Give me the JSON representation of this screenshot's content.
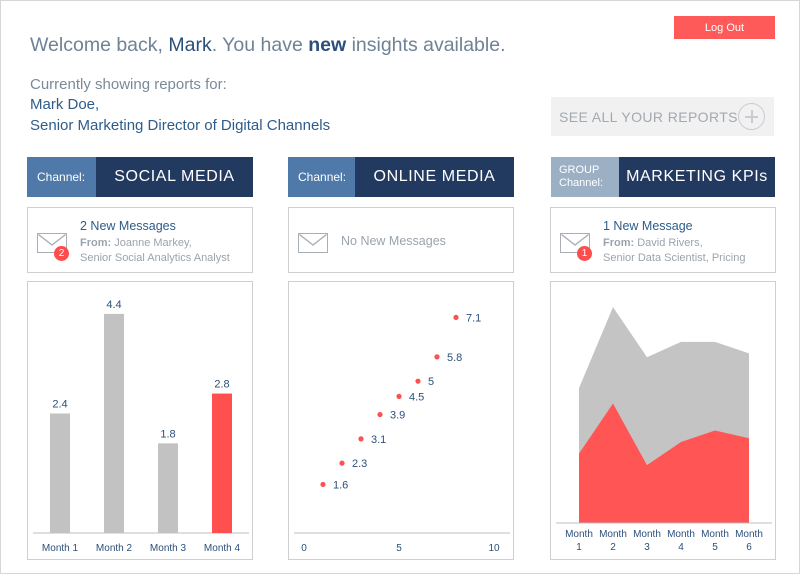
{
  "header": {
    "logout_label": "Log Out",
    "welcome_prefix": "Welcome back, ",
    "welcome_name": "Mark",
    "welcome_mid": ". You have ",
    "welcome_new": "new",
    "welcome_suffix": " insights available.",
    "currently_label": "Currently showing reports for:",
    "user_name": "Mark Doe,",
    "user_title": "Senior Marketing Director of Digital Channels",
    "see_all_label": "SEE ALL YOUR REPORTS"
  },
  "panels": [
    {
      "channel_label": "Channel:",
      "channel_title": "SOCIAL MEDIA",
      "message_title": "2 New Messages",
      "message_from_label": "From:",
      "message_from_name": "Joanne Markey,",
      "message_from_role": "Senior Social Analytics Analyst",
      "badge_count": "2"
    },
    {
      "channel_label": "Channel:",
      "channel_title": "ONLINE MEDIA",
      "message_none": "No New Messages"
    },
    {
      "channel_label_line1": "GROUP",
      "channel_label_line2": "Channel:",
      "channel_title": "MARKETING KPIs",
      "message_title": "1 New Message",
      "message_from_label": "From:",
      "message_from_name": "David Rivers,",
      "message_from_role": "Senior Data Scientist, Pricing",
      "badge_count": "1"
    }
  ],
  "chart_data": [
    {
      "type": "bar",
      "categories": [
        "Month 1",
        "Month 2",
        "Month 3",
        "Month 4"
      ],
      "values": [
        2.4,
        4.4,
        1.8,
        2.8
      ],
      "highlight_index": 3,
      "ylim": [
        0,
        5
      ],
      "colors": {
        "default": "#c2c2c2",
        "highlight": "#ff4f4f"
      }
    },
    {
      "type": "scatter",
      "points": [
        {
          "x": 1,
          "y": 1.6
        },
        {
          "x": 2,
          "y": 2.3
        },
        {
          "x": 3,
          "y": 3.1
        },
        {
          "x": 4,
          "y": 3.9
        },
        {
          "x": 5,
          "y": 4.5
        },
        {
          "x": 6,
          "y": 5
        },
        {
          "x": 7,
          "y": 5.8
        },
        {
          "x": 8,
          "y": 7.1
        }
      ],
      "xlim": [
        0,
        10
      ],
      "xticks": [
        0,
        5,
        10
      ],
      "ylim": [
        0,
        8.2
      ],
      "colors": {
        "point": "#ff4f4f"
      }
    },
    {
      "type": "area",
      "categories": [
        [
          "Month",
          "1"
        ],
        [
          "Month",
          "2"
        ],
        [
          "Month",
          "3"
        ],
        [
          "Month",
          "4"
        ],
        [
          "Month",
          "5"
        ],
        [
          "Month",
          "6"
        ]
      ],
      "series": [
        {
          "values": [
            3.5,
            5.6,
            4.3,
            4.7,
            4.7,
            4.4
          ]
        },
        {
          "values": [
            1.8,
            3.1,
            1.5,
            2.1,
            2.4,
            2.2
          ]
        }
      ],
      "ylim": [
        0,
        6.2
      ],
      "colors": {
        "back": "#c4c4c4",
        "front": "#ff5555"
      }
    }
  ],
  "colors": {
    "accent_red": "#ff5a5a",
    "navy": "#233a60",
    "channel_blue": "#4f79a8"
  }
}
